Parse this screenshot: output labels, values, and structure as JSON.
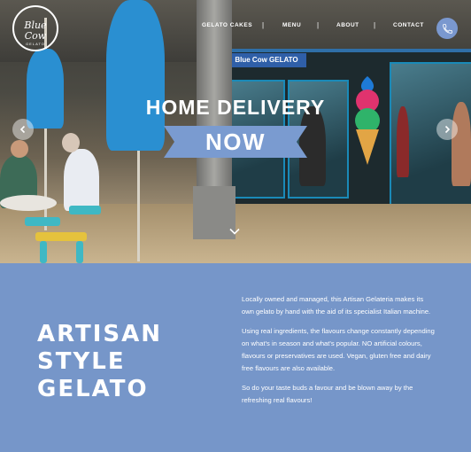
{
  "logo": {
    "line1": "Blue Cow",
    "line2": "GELATO"
  },
  "nav": {
    "items": [
      "GELATO CAKES",
      "MENU",
      "ABOUT",
      "CONTACT"
    ],
    "separator": "|"
  },
  "hero": {
    "line1": "HOME DELIVERY",
    "line2": "NOW",
    "shop_sign": "Blue Cow GELATO"
  },
  "content": {
    "heading": [
      "ARTISAN",
      "STYLE",
      "GELATO"
    ],
    "paragraphs": [
      "Locally owned and managed, this Artisan Gelateria makes its own gelato by hand with the aid of its specialist Italian machine.",
      "Using real ingredients, the flavours change constantly depending on what's in season and what's popular. NO artificial colours, flavours or preservatives are used. Vegan, gluten free and dairy free flavours are also available.",
      "So do your taste buds a favour and be blown away by the refreshing real flavours!"
    ]
  },
  "colors": {
    "brand_blue": "#7696c9",
    "ribbon": "#7a9bd0",
    "white": "#ffffff"
  },
  "icons": {
    "phone": "phone-icon",
    "prev": "chevron-left-icon",
    "next": "chevron-right-icon",
    "scroll": "chevron-down-icon"
  }
}
